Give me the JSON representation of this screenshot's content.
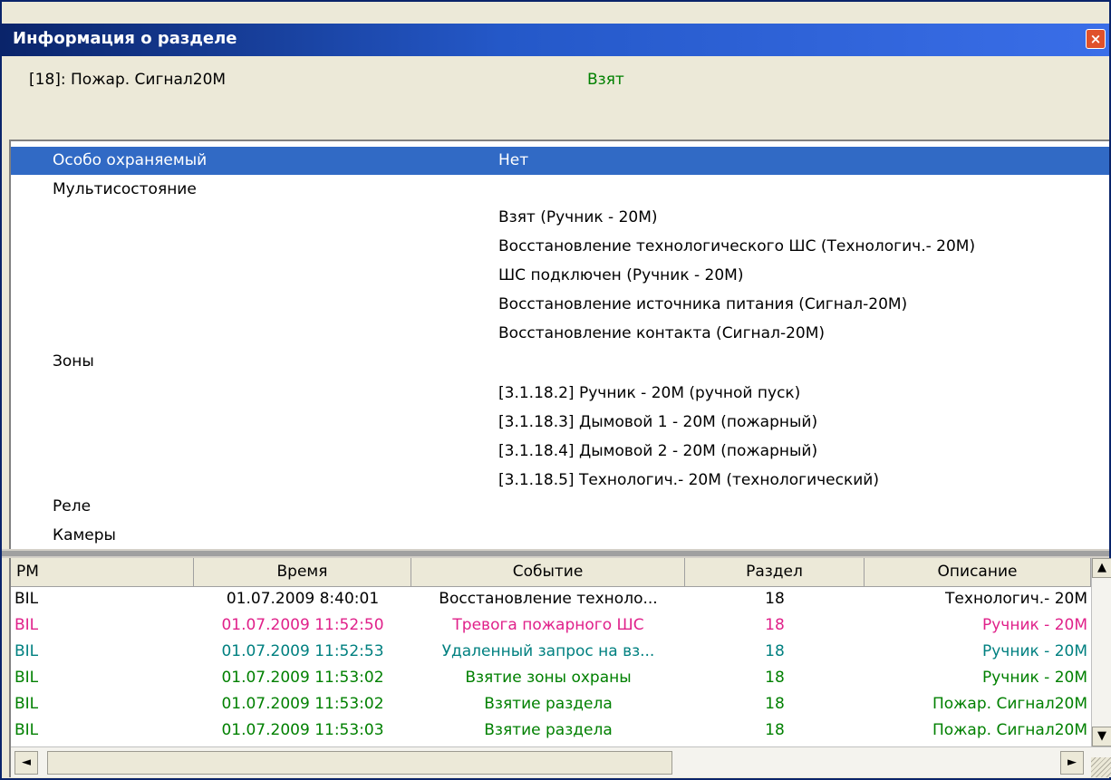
{
  "window": {
    "title": "Информация о разделе",
    "close_symbol": "×"
  },
  "section": {
    "name": "[18]: Пожар. Сигнал20М",
    "status": "Взят",
    "status_color": "#008000"
  },
  "properties": {
    "selected": {
      "label": "Особо охраняемый",
      "value": "Нет"
    },
    "multistate_label": "Мультисостояние",
    "multistate_values": [
      "Взят (Ручник - 20М)",
      "Восстановление технологического ШС (Технологич.- 20М)",
      "ШС подключен (Ручник - 20М)",
      "Восстановление источника питания (Сигнал-20М)",
      "Восстановление контакта (Сигнал-20М)"
    ],
    "zones_label": "Зоны",
    "zones_values": [
      "[3.1.18.2] Ручник - 20М (ручной пуск)",
      "[3.1.18.3] Дымовой 1 - 20М (пожарный)",
      "[3.1.18.4] Дымовой 2 - 20М (пожарный)",
      "[3.1.18.5] Технологич.- 20М (технологический)"
    ],
    "relay_label": "Реле",
    "cameras_label": "Камеры"
  },
  "events": {
    "columns": [
      "РМ",
      "Время",
      "Событие",
      "Раздел",
      "Описание"
    ],
    "rows": [
      {
        "rm": "BIL",
        "time": "01.07.2009 8:40:01",
        "event": "Восстановление техноло...",
        "section": "18",
        "desc": "Технологич.- 20М",
        "color": "#000000"
      },
      {
        "rm": "BIL",
        "time": "01.07.2009 11:52:50",
        "event": "Тревога пожарного ШС",
        "section": "18",
        "desc": "Ручник - 20М",
        "color": "#e0218a"
      },
      {
        "rm": "BIL",
        "time": "01.07.2009 11:52:53",
        "event": "Удаленный запрос на вз...",
        "section": "18",
        "desc": "Ручник - 20М",
        "color": "#008080"
      },
      {
        "rm": "BIL",
        "time": "01.07.2009 11:53:02",
        "event": "Взятие зоны охраны",
        "section": "18",
        "desc": "Ручник - 20М",
        "color": "#008000"
      },
      {
        "rm": "BIL",
        "time": "01.07.2009 11:53:02",
        "event": "Взятие раздела",
        "section": "18",
        "desc": "Пожар. Сигнал20М",
        "color": "#008000"
      },
      {
        "rm": "BIL",
        "time": "01.07.2009 11:53:03",
        "event": "Взятие раздела",
        "section": "18",
        "desc": "Пожар. Сигнал20М",
        "color": "#008000"
      }
    ]
  },
  "scroll_symbols": {
    "up": "▲",
    "down": "▼",
    "left": "◄",
    "right": "►"
  }
}
